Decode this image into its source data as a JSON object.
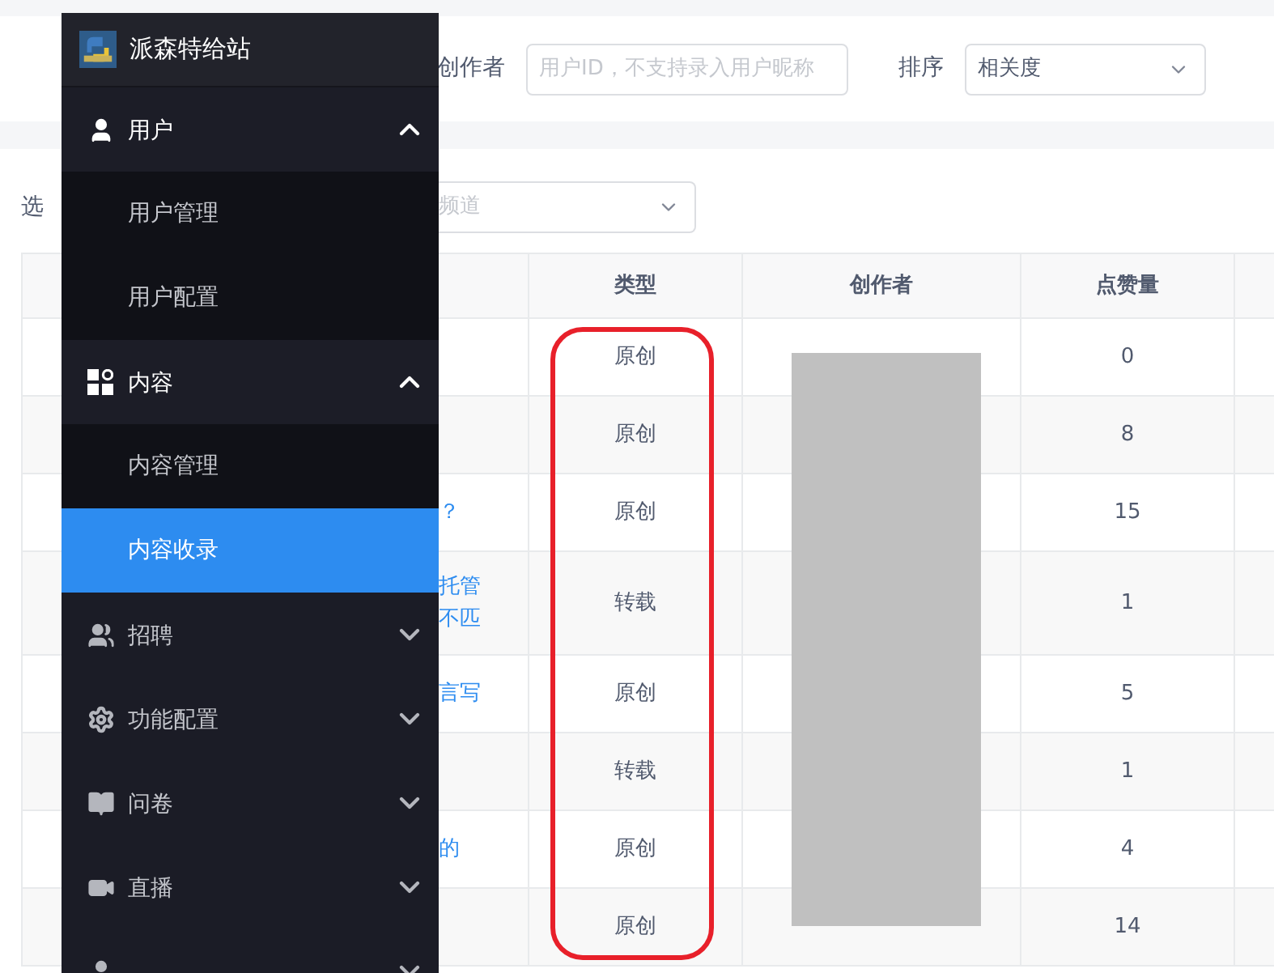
{
  "site": {
    "title": "派森特给站"
  },
  "nav": [
    {
      "label": "用户",
      "kind": "user",
      "expanded": true,
      "children": [
        {
          "label": "用户管理",
          "selected": false
        },
        {
          "label": "用户配置",
          "selected": false
        }
      ]
    },
    {
      "label": "内容",
      "kind": "grid",
      "expanded": true,
      "children": [
        {
          "label": "内容管理",
          "selected": false
        },
        {
          "label": "内容收录",
          "selected": true
        }
      ]
    },
    {
      "label": "招聘",
      "kind": "people",
      "expanded": false
    },
    {
      "label": "功能配置",
      "kind": "gear",
      "expanded": false
    },
    {
      "label": "问卷",
      "kind": "book",
      "expanded": false
    },
    {
      "label": "直播",
      "kind": "video",
      "expanded": false
    },
    {
      "kind": "user",
      "expanded": false
    }
  ],
  "search": {
    "creator_label": "创作者",
    "creator_placeholder": "用户ID，不支持录入用户昵称",
    "sort_label": "排序",
    "sort_value": "相关度"
  },
  "filter": {
    "label": "选",
    "channel_placeholder": "频道"
  },
  "table": {
    "columns": [
      "类型",
      "创作者",
      "点赞量"
    ],
    "rows": [
      {
        "title": [],
        "type": "原创",
        "likes": "0"
      },
      {
        "title": [],
        "type": "原创",
        "likes": "8"
      },
      {
        "title": [
          "？"
        ],
        "type": "原创",
        "likes": "15"
      },
      {
        "title": [
          "托管",
          "不匹"
        ],
        "type": "转载",
        "likes": "1"
      },
      {
        "title": [
          "言写"
        ],
        "type": "原创",
        "likes": "5"
      },
      {
        "title": [],
        "type": "转载",
        "likes": "1"
      },
      {
        "title": [
          "的"
        ],
        "type": "原创",
        "likes": "4"
      },
      {
        "title": [],
        "type": "原创",
        "likes": "14"
      }
    ]
  },
  "annotations": [
    {
      "kind": "highlight-frame",
      "color": "#e8202a"
    },
    {
      "kind": "redaction",
      "color": "#c0c0c0"
    }
  ]
}
